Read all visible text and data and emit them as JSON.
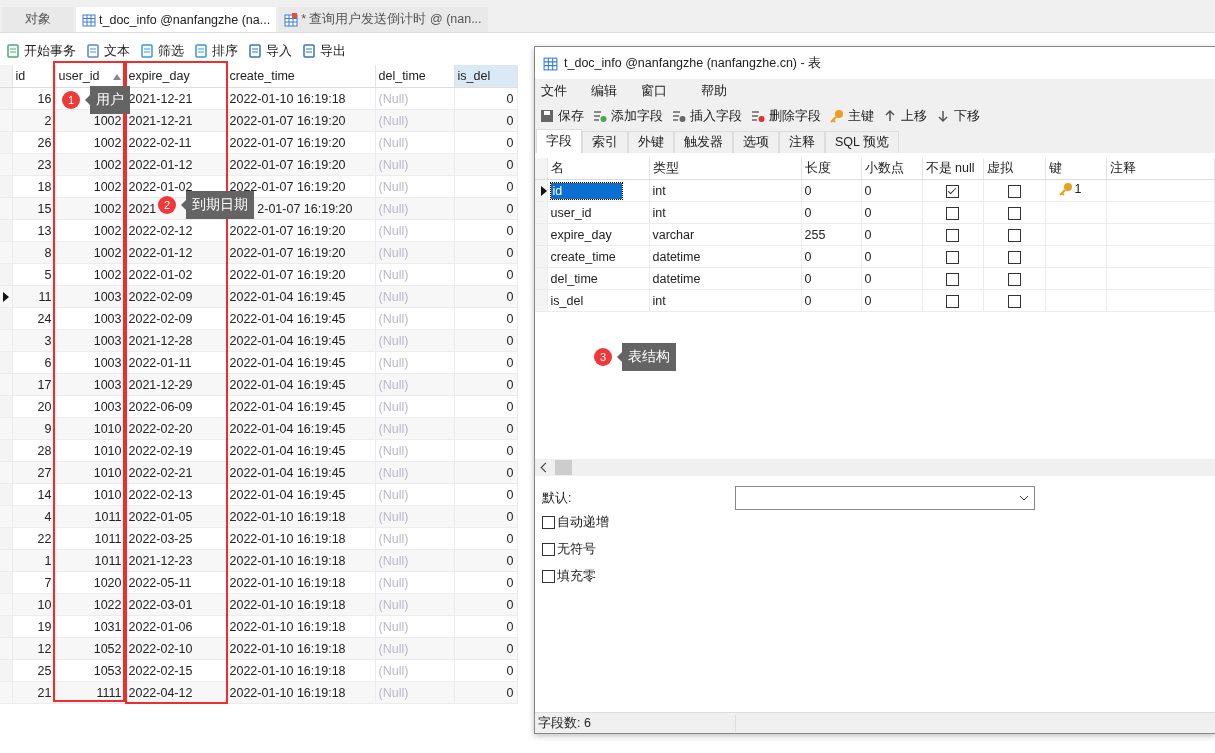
{
  "tabs": [
    {
      "label": "对象",
      "kind": "plain",
      "selected": false
    },
    {
      "label": "t_doc_info @nanfangzhe (na...",
      "kind": "table",
      "selected": true
    },
    {
      "label": "* 查询用户发送倒计时 @ (nan...",
      "kind": "query",
      "selected": false
    }
  ],
  "toolbar": [
    {
      "label": "开始事务",
      "kind": "transaction"
    },
    {
      "label": "文本",
      "kind": "text"
    },
    {
      "label": "筛选",
      "kind": "filter"
    },
    {
      "label": "排序",
      "kind": "sort"
    },
    {
      "label": "导入",
      "kind": "import"
    },
    {
      "label": "导出",
      "kind": "export"
    }
  ],
  "grid": {
    "columns": [
      {
        "label": "id",
        "kind": "number",
        "sorted": false
      },
      {
        "label": "user_id",
        "kind": "number",
        "sorted": true
      },
      {
        "label": "expire_day",
        "kind": "text",
        "sorted": false
      },
      {
        "label": "create_time",
        "kind": "text",
        "sorted": false
      },
      {
        "label": "del_time",
        "kind": "null",
        "sorted": false
      },
      {
        "label": "is_del",
        "kind": "number",
        "sorted": false
      }
    ],
    "rows": [
      {
        "selected": false,
        "cells": [
          "16",
          null,
          "2021-12-21",
          "2022-01-10 16:19:18",
          "(Null)",
          "0"
        ]
      },
      {
        "selected": false,
        "cells": [
          "2",
          "1002",
          "2021-12-21",
          "2022-01-07 16:19:20",
          "(Null)",
          "0"
        ]
      },
      {
        "selected": false,
        "cells": [
          "26",
          "1002",
          "2022-02-11",
          "2022-01-07 16:19:20",
          "(Null)",
          "0"
        ]
      },
      {
        "selected": false,
        "cells": [
          "23",
          "1002",
          "2022-01-12",
          "2022-01-07 16:19:20",
          "(Null)",
          "0"
        ]
      },
      {
        "selected": false,
        "cells": [
          "18",
          "1002",
          "2022-01-02",
          "2022-01-07 16:19:20",
          "(Null)",
          "0"
        ]
      },
      {
        "selected": false,
        "cells": [
          "15",
          "1002",
          "2021",
          "2-01-07 16:19:20",
          "(Null)",
          "0"
        ]
      },
      {
        "selected": false,
        "cells": [
          "13",
          "1002",
          "2022-02-12",
          "2022-01-07 16:19:20",
          "(Null)",
          "0"
        ]
      },
      {
        "selected": false,
        "cells": [
          "8",
          "1002",
          "2022-01-12",
          "2022-01-07 16:19:20",
          "(Null)",
          "0"
        ]
      },
      {
        "selected": false,
        "cells": [
          "5",
          "1002",
          "2022-01-02",
          "2022-01-07 16:19:20",
          "(Null)",
          "0"
        ]
      },
      {
        "selected": true,
        "cells": [
          "11",
          "1003",
          "2022-02-09",
          "2022-01-04 16:19:45",
          "(Null)",
          "0"
        ]
      },
      {
        "selected": false,
        "cells": [
          "24",
          "1003",
          "2022-02-09",
          "2022-01-04 16:19:45",
          "(Null)",
          "0"
        ]
      },
      {
        "selected": false,
        "cells": [
          "3",
          "1003",
          "2021-12-28",
          "2022-01-04 16:19:45",
          "(Null)",
          "0"
        ]
      },
      {
        "selected": false,
        "cells": [
          "6",
          "1003",
          "2022-01-11",
          "2022-01-04 16:19:45",
          "(Null)",
          "0"
        ]
      },
      {
        "selected": false,
        "cells": [
          "17",
          "1003",
          "2021-12-29",
          "2022-01-04 16:19:45",
          "(Null)",
          "0"
        ]
      },
      {
        "selected": false,
        "cells": [
          "20",
          "1003",
          "2022-06-09",
          "2022-01-04 16:19:45",
          "(Null)",
          "0"
        ]
      },
      {
        "selected": false,
        "cells": [
          "9",
          "1010",
          "2022-02-20",
          "2022-01-04 16:19:45",
          "(Null)",
          "0"
        ]
      },
      {
        "selected": false,
        "cells": [
          "28",
          "1010",
          "2022-02-19",
          "2022-01-04 16:19:45",
          "(Null)",
          "0"
        ]
      },
      {
        "selected": false,
        "cells": [
          "27",
          "1010",
          "2022-02-21",
          "2022-01-04 16:19:45",
          "(Null)",
          "0"
        ]
      },
      {
        "selected": false,
        "cells": [
          "14",
          "1010",
          "2022-02-13",
          "2022-01-04 16:19:45",
          "(Null)",
          "0"
        ]
      },
      {
        "selected": false,
        "cells": [
          "4",
          "1011",
          "2022-01-05",
          "2022-01-10 16:19:18",
          "(Null)",
          "0"
        ]
      },
      {
        "selected": false,
        "cells": [
          "22",
          "1011",
          "2022-03-25",
          "2022-01-10 16:19:18",
          "(Null)",
          "0"
        ]
      },
      {
        "selected": false,
        "cells": [
          "1",
          "1011",
          "2021-12-23",
          "2022-01-10 16:19:18",
          "(Null)",
          "0"
        ]
      },
      {
        "selected": false,
        "cells": [
          "7",
          "1020",
          "2022-05-11",
          "2022-01-10 16:19:18",
          "(Null)",
          "0"
        ]
      },
      {
        "selected": false,
        "cells": [
          "10",
          "1022",
          "2022-03-01",
          "2022-01-10 16:19:18",
          "(Null)",
          "0"
        ]
      },
      {
        "selected": false,
        "cells": [
          "19",
          "1031",
          "2022-01-06",
          "2022-01-10 16:19:18",
          "(Null)",
          "0"
        ]
      },
      {
        "selected": false,
        "cells": [
          "12",
          "1052",
          "2022-02-10",
          "2022-01-10 16:19:18",
          "(Null)",
          "0"
        ]
      },
      {
        "selected": false,
        "cells": [
          "25",
          "1053",
          "2022-02-15",
          "2022-01-10 16:19:18",
          "(Null)",
          "0"
        ]
      },
      {
        "selected": false,
        "cells": [
          "21",
          "1111",
          "2022-04-12",
          "2022-01-10 16:19:18",
          "(Null)",
          "0"
        ]
      }
    ]
  },
  "dialog": {
    "title": "t_doc_info @nanfangzhe (nanfangzhe.cn) - 表",
    "menu": [
      "文件",
      "编辑",
      "窗口",
      "帮助"
    ],
    "toolbar": [
      {
        "label": "保存",
        "kind": "save"
      },
      {
        "label": "添加字段",
        "kind": "add"
      },
      {
        "label": "插入字段",
        "kind": "insert"
      },
      {
        "label": "删除字段",
        "kind": "delete"
      },
      {
        "label": "主键",
        "kind": "key"
      },
      {
        "label": "上移",
        "kind": "up"
      },
      {
        "label": "下移",
        "kind": "down"
      }
    ],
    "tabs": [
      {
        "label": "字段",
        "selected": true
      },
      {
        "label": "索引",
        "selected": false
      },
      {
        "label": "外键",
        "selected": false
      },
      {
        "label": "触发器",
        "selected": false
      },
      {
        "label": "选项",
        "selected": false
      },
      {
        "label": "注释",
        "selected": false
      },
      {
        "label": "SQL 预览",
        "selected": false
      }
    ],
    "columns": [
      "名",
      "类型",
      "长度",
      "小数点",
      "不是 null",
      "虚拟",
      "键",
      "注释"
    ],
    "fields": [
      {
        "name": "id",
        "type": "int",
        "length": "0",
        "decimals": "0",
        "not_null": true,
        "virtual": false,
        "key": "1",
        "selected": true
      },
      {
        "name": "user_id",
        "type": "int",
        "length": "0",
        "decimals": "0",
        "not_null": false,
        "virtual": false,
        "selected": false
      },
      {
        "name": "expire_day",
        "type": "varchar",
        "length": "255",
        "decimals": "0",
        "not_null": false,
        "virtual": false,
        "selected": false
      },
      {
        "name": "create_time",
        "type": "datetime",
        "length": "0",
        "decimals": "0",
        "not_null": false,
        "virtual": false,
        "selected": false
      },
      {
        "name": "del_time",
        "type": "datetime",
        "length": "0",
        "decimals": "0",
        "not_null": false,
        "virtual": false,
        "selected": false
      },
      {
        "name": "is_del",
        "type": "int",
        "length": "0",
        "decimals": "0",
        "not_null": false,
        "virtual": false,
        "selected": false
      }
    ],
    "default_label": "默认:",
    "options": [
      {
        "label": "自动递增",
        "checked": false
      },
      {
        "label": "无符号",
        "checked": false
      },
      {
        "label": "填充零",
        "checked": false
      }
    ],
    "status": "字段数: 6"
  },
  "annotations": [
    {
      "number": "1",
      "label": "用户"
    },
    {
      "number": "2",
      "label": "到期日期"
    },
    {
      "number": "3",
      "label": "表结构"
    }
  ]
}
